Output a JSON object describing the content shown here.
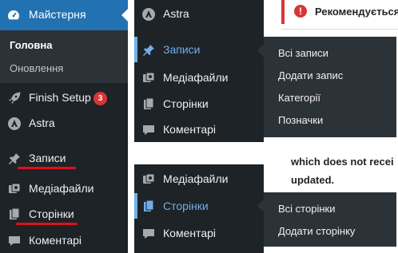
{
  "panel1": {
    "active_label": "Майстерня",
    "submenu": {
      "home": "Головна",
      "updates": "Оновлення"
    },
    "items": [
      {
        "label": "Finish Setup",
        "icon": "rocket-icon",
        "badge": "3"
      },
      {
        "label": "Astra",
        "icon": "astra-icon"
      },
      {
        "label": "Записи",
        "icon": "pin-icon"
      },
      {
        "label": "Медіафайли",
        "icon": "media-icon"
      },
      {
        "label": "Сторінки",
        "icon": "pages-icon"
      },
      {
        "label": "Коментарі",
        "icon": "comment-icon"
      }
    ]
  },
  "panel2": {
    "astra": "Astra",
    "posts": "Записи",
    "media": "Медіафайли",
    "pages": "Сторінки",
    "comments": "Коментарі",
    "flyout": [
      "Всі записи",
      "Додати запис",
      "Категорії",
      "Позначки"
    ]
  },
  "panel3": {
    "media": "Медіафайли",
    "pages": "Сторінки",
    "comments": "Коментарі",
    "flyout": [
      "Всі сторінки",
      "Додати сторінку"
    ]
  },
  "notice": {
    "title": "Рекомендується",
    "line1": "which does not recei",
    "line2": "updated."
  },
  "colors": {
    "sidebar_bg": "#1d2327",
    "submenu_bg": "#2c3338",
    "active_bg": "#2271b1",
    "current_text": "#72aee6",
    "underline": "#e0101a",
    "badge": "#d63638"
  }
}
